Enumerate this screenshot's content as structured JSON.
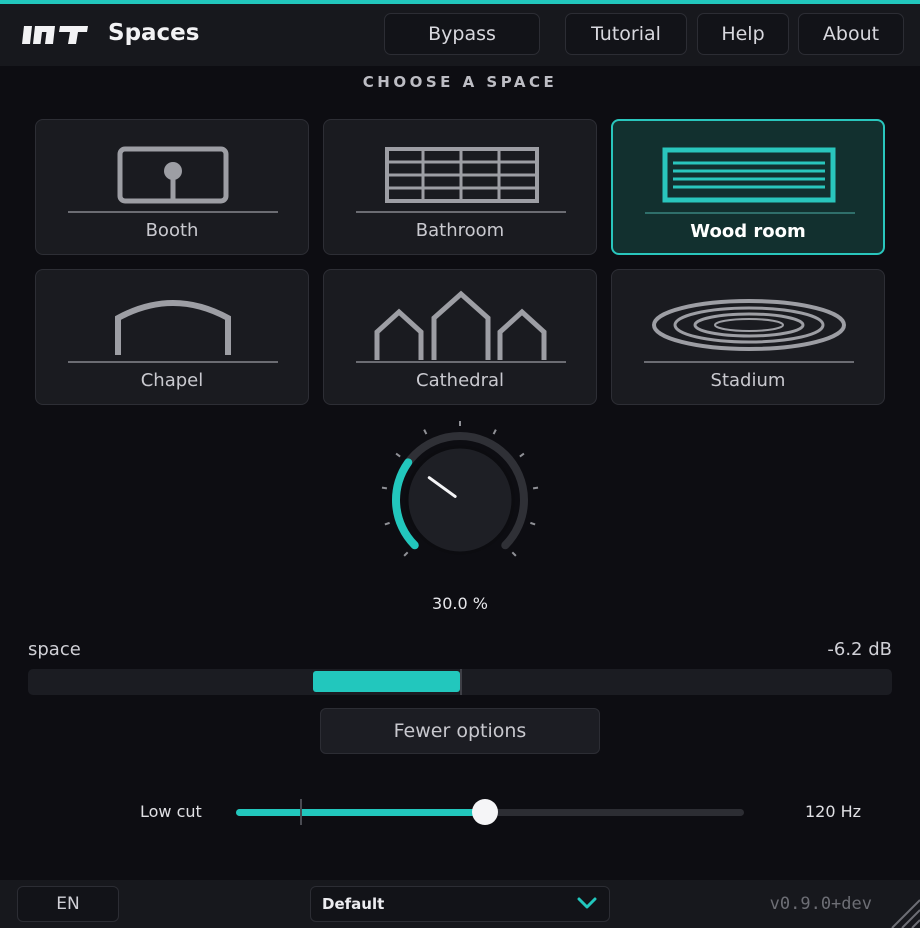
{
  "header": {
    "title": "Spaces",
    "buttons": {
      "bypass": "Bypass",
      "tutorial": "Tutorial",
      "help": "Help",
      "about": "About"
    }
  },
  "spaces": {
    "title": "CHOOSE A SPACE",
    "tiles": [
      "Booth",
      "Bathroom",
      "Wood room",
      "Chapel",
      "Cathedral",
      "Stadium"
    ],
    "selected": "Wood room"
  },
  "knob": {
    "value_label": "30.0 %",
    "value_fraction": 0.3
  },
  "space_meter": {
    "label": "space",
    "value_label": "-6.2 dB",
    "fill_start": 0.33,
    "fill_end": 0.5
  },
  "fewer_options": "Fewer options",
  "low_cut": {
    "label": "Low cut",
    "value_label": "120 Hz",
    "value_fraction": 0.49
  },
  "footer": {
    "language": "EN",
    "preset": "Default",
    "version": "v0.9.0+dev"
  },
  "colors": {
    "accent": "#22c7bd",
    "background": "#0d0d12",
    "panel": "#17181d"
  }
}
